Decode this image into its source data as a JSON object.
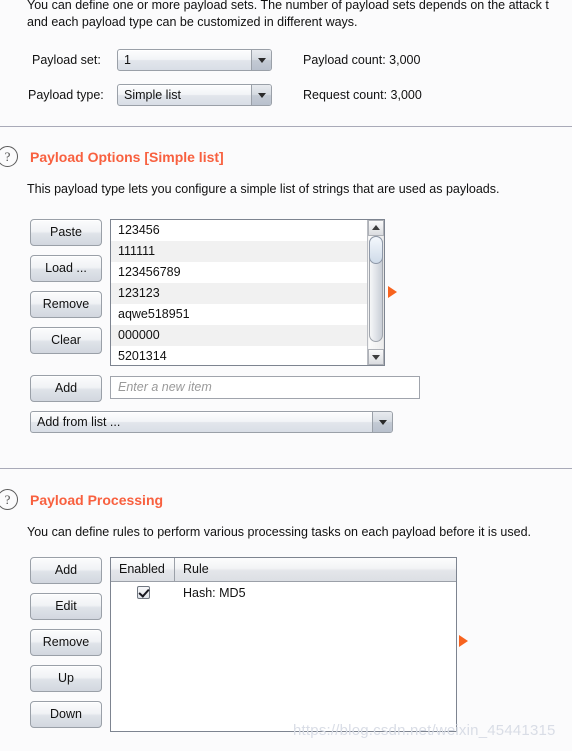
{
  "intro": {
    "line1": "You can define one or more payload sets. The number of payload sets depends on the attack t",
    "line2": "and each payload type can be customized in different ways."
  },
  "payload_set": {
    "label": "Payload set:",
    "value": "1",
    "count_label": "Payload count:  3,000"
  },
  "payload_type": {
    "label": "Payload type:",
    "value": "Simple list",
    "count_label": "Request count:  3,000"
  },
  "payload_options": {
    "help_glyph": "?",
    "title": "Payload Options [Simple list]",
    "description": "This payload type lets you configure a simple list of strings that are used as payloads.",
    "buttons": [
      {
        "label": "Paste"
      },
      {
        "label": "Load ..."
      },
      {
        "label": "Remove"
      },
      {
        "label": "Clear"
      }
    ],
    "list_items": [
      "123456",
      "111111",
      "123456789",
      "123123",
      "aqwe518951",
      "000000",
      "5201314"
    ],
    "add_button": "Add",
    "new_item_placeholder": "Enter a new item",
    "add_from_list": "Add from list ..."
  },
  "payload_processing": {
    "help_glyph": "?",
    "title": "Payload Processing",
    "description": "You can define rules to perform various processing tasks on each payload before it is used.",
    "buttons": [
      {
        "label": "Add"
      },
      {
        "label": "Edit"
      },
      {
        "label": "Remove"
      },
      {
        "label": "Up"
      },
      {
        "label": "Down"
      }
    ],
    "columns": [
      "Enabled",
      "Rule"
    ],
    "rows": [
      {
        "enabled": true,
        "rule": "Hash: MD5"
      }
    ]
  },
  "watermark": "https://blog.csdn.net/weixin_45441315",
  "colors": {
    "accent": "#f8603f",
    "marker": "#f7631f",
    "separator": "#a9aab8"
  }
}
